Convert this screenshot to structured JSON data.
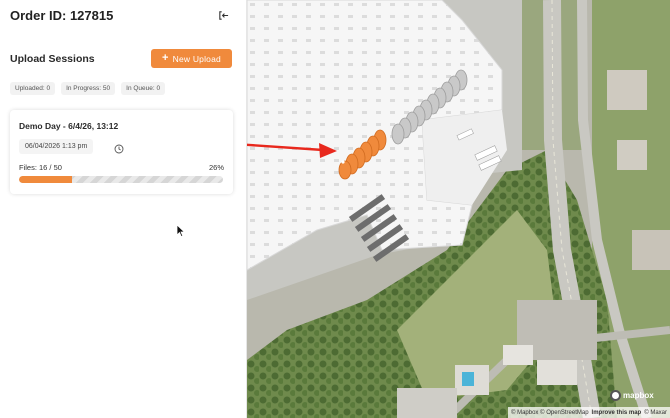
{
  "header": {
    "order_title": "Order ID: 127815",
    "collapse_icon": "collapse-icon"
  },
  "sessions": {
    "title": "Upload Sessions",
    "new_upload_label": "New Upload",
    "new_upload_icon": "+",
    "stats": {
      "uploaded": "Uploaded: 0",
      "in_progress": "In Progress: 50",
      "in_queue": "In Queue: 0"
    },
    "items": [
      {
        "title": "Demo Day - 6/4/26, 13:12",
        "date": "06/04/2026 1:13 pm",
        "files": "Files: 16 / 50",
        "percent_label": "26%",
        "progress": 0.26
      }
    ]
  },
  "map": {
    "attribution": "© Mapbox © OpenStreetMap",
    "improve_link": "Improve this map",
    "maxar": "© Maxar",
    "logo": "mapbox"
  },
  "colors": {
    "accent": "#f08a3c",
    "annotation_arrow": "#e8281d"
  }
}
